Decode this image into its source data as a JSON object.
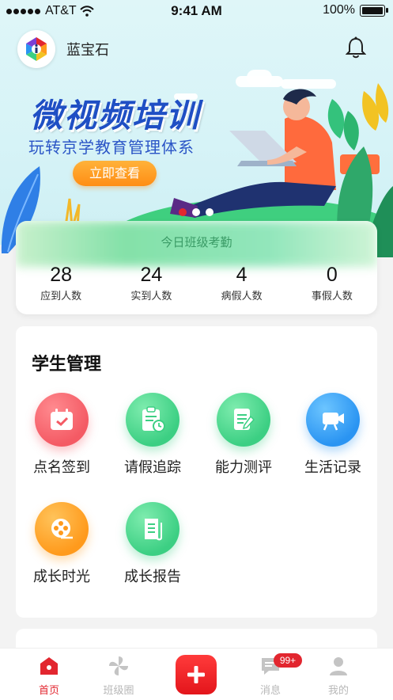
{
  "status_bar": {
    "carrier": "AT&T",
    "time": "9:41 AM",
    "battery": "100%"
  },
  "header": {
    "title": "蓝宝石",
    "logo_icon": "app-logo-icon",
    "bell_icon": "bell-icon"
  },
  "banner": {
    "headline": "微视频培训",
    "subtitle": "玩转京学教育管理体系",
    "cta_label": "立即查看",
    "page_count": 3,
    "active_page": 1
  },
  "attendance": {
    "title": "今日班级考勤",
    "stats": [
      {
        "value": "28",
        "label": "应到人数"
      },
      {
        "value": "24",
        "label": "实到人数"
      },
      {
        "value": "4",
        "label": "病假人数"
      },
      {
        "value": "0",
        "label": "事假人数"
      }
    ]
  },
  "student_management": {
    "title": "学生管理",
    "items": [
      {
        "label": "点名签到",
        "icon": "calendar-check-icon",
        "color": "#f45a64"
      },
      {
        "label": "请假追踪",
        "icon": "clipboard-clock-icon",
        "color": "#3ccf83"
      },
      {
        "label": "能力测评",
        "icon": "document-edit-icon",
        "color": "#3ccf83"
      },
      {
        "label": "生活记录",
        "icon": "camera-icon",
        "color": "#2a94f2"
      },
      {
        "label": "成长时光",
        "icon": "film-reel-icon",
        "color": "#ff9a1c"
      },
      {
        "label": "成长报告",
        "icon": "report-scroll-icon",
        "color": "#3ccf83"
      }
    ]
  },
  "tab_bar": {
    "tabs": [
      {
        "label": "首页",
        "icon": "home-icon",
        "active": true
      },
      {
        "label": "班级圈",
        "icon": "pinwheel-icon",
        "active": false
      },
      {
        "label": "",
        "icon": "plus-icon",
        "active": false
      },
      {
        "label": "消息",
        "icon": "message-icon",
        "active": false
      },
      {
        "label": "我的",
        "icon": "user-icon",
        "active": false
      }
    ],
    "message_badge": "99+"
  },
  "colors": {
    "accent": "#e2262f",
    "brand_blue": "#1f4fc4",
    "cta_orange": "#ff9a1c"
  }
}
